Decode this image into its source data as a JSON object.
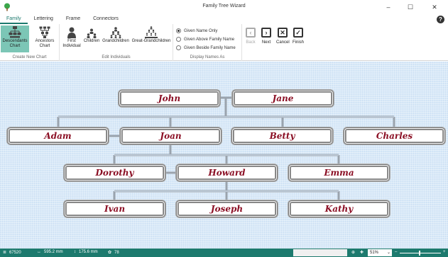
{
  "window": {
    "title": "Family Tree Wizard",
    "minimize_glyph": "–",
    "maximize_glyph": "☐",
    "close_glyph": "✕",
    "help_glyph": "?"
  },
  "tabs": [
    "Family",
    "Lettering",
    "Frame",
    "Connectors"
  ],
  "ribbon": {
    "create_chart": {
      "label": "Create New Chart",
      "descendants_l1": "Descendants",
      "descendants_l2": "Chart",
      "ancestors_l1": "Ancestors",
      "ancestors_l2": "Chart"
    },
    "edit_individuals": {
      "label": "Edit Individuals",
      "first_l1": "First",
      "first_l2": "Individual",
      "children": "Children",
      "grandchildren": "Grandchildren",
      "great_grandchildren": "Great-Grandchildren"
    },
    "display_names": {
      "label": "Display Names As",
      "options": [
        "Given Name Only",
        "Given Above Family Name",
        "Given Beside Family Name"
      ],
      "selected": "Given Name Only"
    },
    "nav": {
      "back": "Back",
      "next": "Next",
      "cancel": "Cancel",
      "finish": "Finish"
    }
  },
  "tree": {
    "names": [
      "John",
      "Jane",
      "Adam",
      "Joan",
      "Betty",
      "Charles",
      "Dorothy",
      "Howard",
      "Emma",
      "Ivan",
      "Joseph",
      "Kathy"
    ]
  },
  "status": {
    "stitches": "67520",
    "width": "595.2 mm",
    "height": "175.6 mm",
    "colors": "78",
    "zoom": "51%",
    "zoom_minus": "–",
    "zoom_plus": "+"
  },
  "colors": {
    "accent": "#1d7a6e",
    "name_text": "#8b0f24",
    "canvas": "#d9e9f8"
  }
}
